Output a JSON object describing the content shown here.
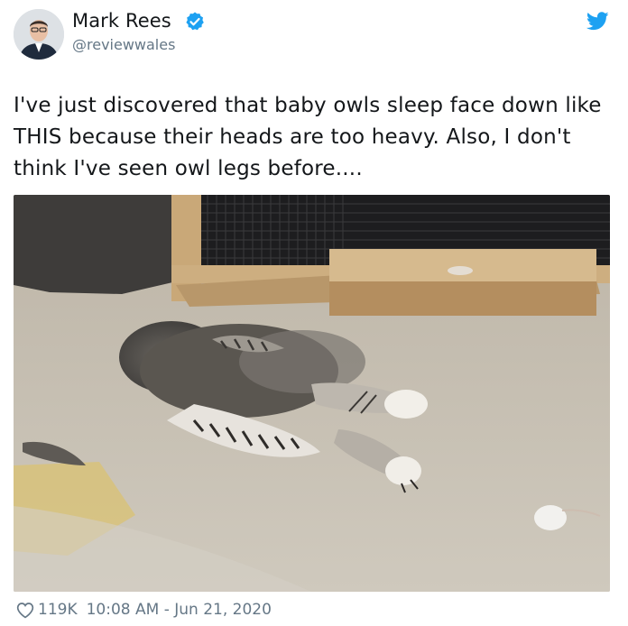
{
  "author": {
    "name": "Mark Rees",
    "handle": "@reviewwales",
    "verified": true
  },
  "tweet": {
    "text": "I've just discovered that baby owls sleep face down like THIS because their heads are too heavy. Also, I don't think I've seen owl legs before...."
  },
  "footer": {
    "likes": "119K",
    "timestamp": "10:08 AM - Jun 21, 2020"
  },
  "icons": {
    "brand": "twitter-bird-icon",
    "verified": "verified-badge-icon",
    "like": "heart-icon"
  },
  "colors": {
    "twitter_blue": "#1da1f2",
    "secondary_text": "#657786",
    "primary_text": "#14171a"
  }
}
